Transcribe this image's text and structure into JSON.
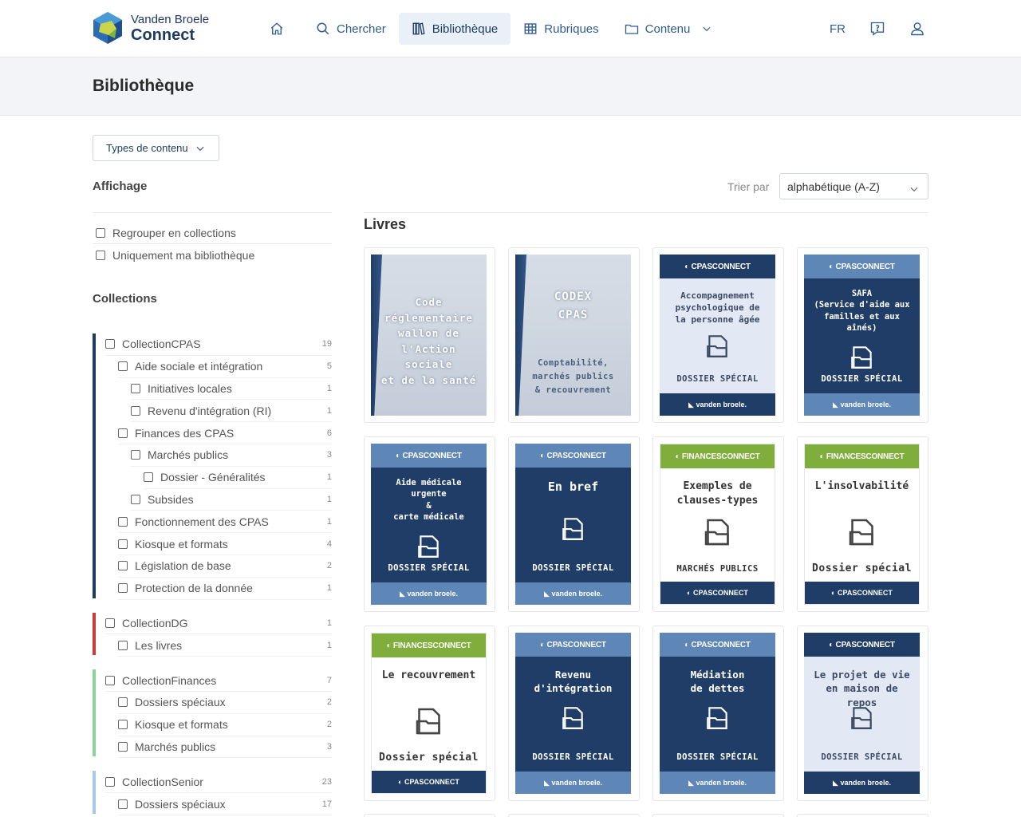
{
  "brand": {
    "line1": "Vanden Broele",
    "line2": "Connect"
  },
  "nav": {
    "home_label": "",
    "search_label": "Chercher",
    "library_label": "Bibliothèque",
    "rubrics_label": "Rubriques",
    "content_label": "Contenu",
    "lang_label": "FR"
  },
  "page": {
    "title": "Bibliothèque"
  },
  "filters": {
    "types_label": "Types de contenu",
    "display_heading": "Affichage",
    "group_collections": "Regrouper en collections",
    "only_my_library": "Uniquement ma bibliothèque",
    "collections_heading": "Collections"
  },
  "collections": [
    {
      "color": "#1f3b64",
      "items": [
        {
          "label": "CollectionCPAS",
          "count": "19",
          "level": 0
        },
        {
          "label": "Aide sociale et intégration",
          "count": "5",
          "level": 1
        },
        {
          "label": "Initiatives locales",
          "count": "1",
          "level": 2
        },
        {
          "label": "Revenu d'intégration (RI)",
          "count": "1",
          "level": 2
        },
        {
          "label": "Finances des CPAS",
          "count": "6",
          "level": 1
        },
        {
          "label": "Marchés publics",
          "count": "3",
          "level": 2
        },
        {
          "label": "Dossier - Généralités",
          "count": "1",
          "level": 3
        },
        {
          "label": "Subsides",
          "count": "1",
          "level": 2
        },
        {
          "label": "Fonctionnement des CPAS",
          "count": "1",
          "level": 1
        },
        {
          "label": "Kiosque et formats",
          "count": "4",
          "level": 1
        },
        {
          "label": "Législation de base",
          "count": "2",
          "level": 1
        },
        {
          "label": "Protection de la donnée",
          "count": "1",
          "level": 1
        }
      ]
    },
    {
      "color": "#d0393b",
      "items": [
        {
          "label": "CollectionDG",
          "count": "1",
          "level": 0
        },
        {
          "label": "Les livres",
          "count": "1",
          "level": 1
        }
      ]
    },
    {
      "color": "#8fd19a",
      "items": [
        {
          "label": "CollectionFinances",
          "count": "7",
          "level": 0
        },
        {
          "label": "Dossiers spéciaux",
          "count": "2",
          "level": 1
        },
        {
          "label": "Kiosque et formats",
          "count": "2",
          "level": 1
        },
        {
          "label": "Marchés publics",
          "count": "3",
          "level": 1
        }
      ]
    },
    {
      "color": "#a9c7e8",
      "items": [
        {
          "label": "CollectionSenior",
          "count": "23",
          "level": 0
        },
        {
          "label": "Dossiers spéciaux",
          "count": "17",
          "level": 1
        }
      ]
    }
  ],
  "sort": {
    "label": "Trier par",
    "value": "alphabétique (A-Z)"
  },
  "section_title": "Livres",
  "books": [
    {
      "style": "photo",
      "title": "Code\nréglementaire\nwallon de\nl'Action sociale\net de la santé",
      "subtitle": ""
    },
    {
      "style": "photo",
      "title": "CODEX\nCPAS",
      "subtitle": "Comptabilité,\nmarchés publics\n& recouvrement"
    },
    {
      "style": "light",
      "brand": "CPASCONNECT",
      "title": "Accompagnement\npsychologique de\nla personne âgée",
      "footer": "DOSSIER SPÉCIAL",
      "bottom": "vanden broele."
    },
    {
      "style": "dark",
      "brand": "CPASCONNECT",
      "title": "SAFA\n(Service d'aide aux\nfamilles et aux\naînés)",
      "footer": "DOSSIER SPÉCIAL",
      "bottom": "vanden broele."
    },
    {
      "style": "dark",
      "brand": "CPASCONNECT",
      "title": "Aide médicale\nurgente\n&\ncarte médicale",
      "footer": "DOSSIER SPÉCIAL",
      "bottom": "vanden broele."
    },
    {
      "style": "dark",
      "brand": "CPASCONNECT",
      "title": "En bref",
      "footer": "DOSSIER SPÉCIAL",
      "bottom": "vanden broele."
    },
    {
      "style": "white-green",
      "brand": "FINANCESCONNECT",
      "title": "Exemples de\nclauses-types",
      "footer": "MARCHÉS PUBLICS",
      "bottom": "CPASCONNECT"
    },
    {
      "style": "white-green",
      "brand": "FINANCESCONNECT",
      "title": "L'insolvabilité",
      "footer": "Dossier spécial",
      "bottom": "CPASCONNECT"
    },
    {
      "style": "white-green",
      "brand": "FINANCESCONNECT",
      "title": "Le recouvrement",
      "footer": "Dossier spécial",
      "bottom": "CPASCONNECT"
    },
    {
      "style": "dark",
      "brand": "CPASCONNECT",
      "title": "Revenu\nd'intégration",
      "footer": "DOSSIER SPÉCIAL",
      "bottom": "vanden broele."
    },
    {
      "style": "dark",
      "brand": "CPASCONNECT",
      "title": "Médiation\nde dettes",
      "footer": "DOSSIER SPÉCIAL",
      "bottom": "vanden broele."
    },
    {
      "style": "light",
      "brand": "CPASCONNECT",
      "title": "Le projet de vie\nen maison de repos",
      "footer": "DOSSIER SPÉCIAL",
      "bottom": "vanden broele."
    }
  ]
}
